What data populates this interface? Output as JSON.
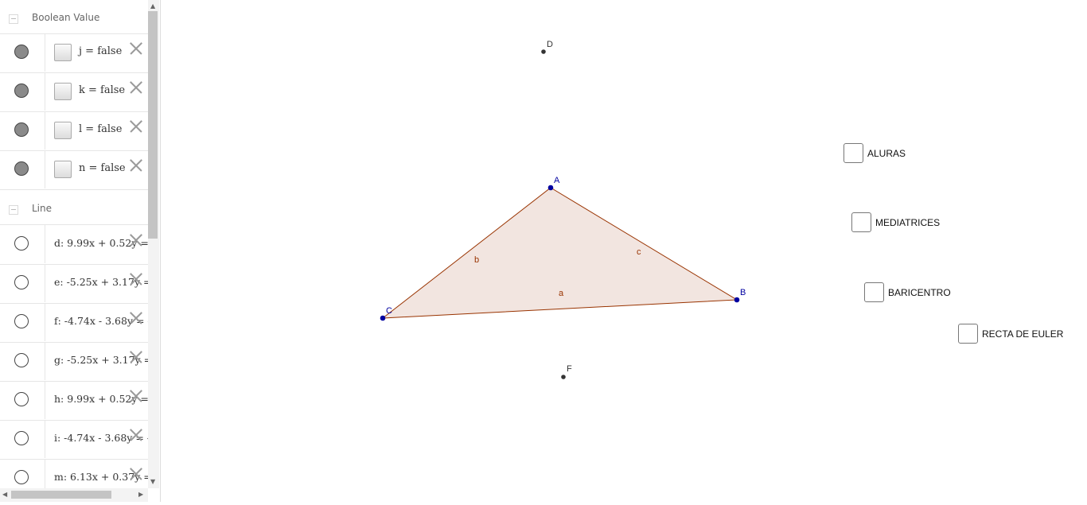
{
  "algebra": {
    "boolean_group": {
      "label": "Boolean Value"
    },
    "booleans": [
      {
        "text": "j = false"
      },
      {
        "text": "k = false"
      },
      {
        "text": "l = false"
      },
      {
        "text": "n = false"
      }
    ],
    "line_group": {
      "label": "Line"
    },
    "lines": [
      {
        "text": "d: 9.99x + 0.52y = "
      },
      {
        "text": "e: -5.25x + 3.17y = "
      },
      {
        "text": "f: -4.74x - 3.68y = -"
      },
      {
        "text": "g: -5.25x + 3.17y = "
      },
      {
        "text": "h: 9.99x + 0.52y = "
      },
      {
        "text": "i: -4.74x - 3.68y = -"
      },
      {
        "text": "m: 6.13x + 0.37y = "
      }
    ]
  },
  "graphics": {
    "points": {
      "A": "A",
      "B": "B",
      "C": "C",
      "D": "D",
      "F": "F"
    },
    "sides": {
      "a": "a",
      "b": "b",
      "c": "c"
    },
    "checkboxes": {
      "alturas": "ALURAS",
      "mediatrices": "MEDIATRICES",
      "baricentro": "BARICENTRO",
      "euler": "RECTA DE EULER"
    }
  },
  "colors": {
    "point_blue": "#0000a0",
    "polygon_stroke": "#993300",
    "polygon_fill": "#f2e5e0",
    "aux_point": "#333333"
  }
}
